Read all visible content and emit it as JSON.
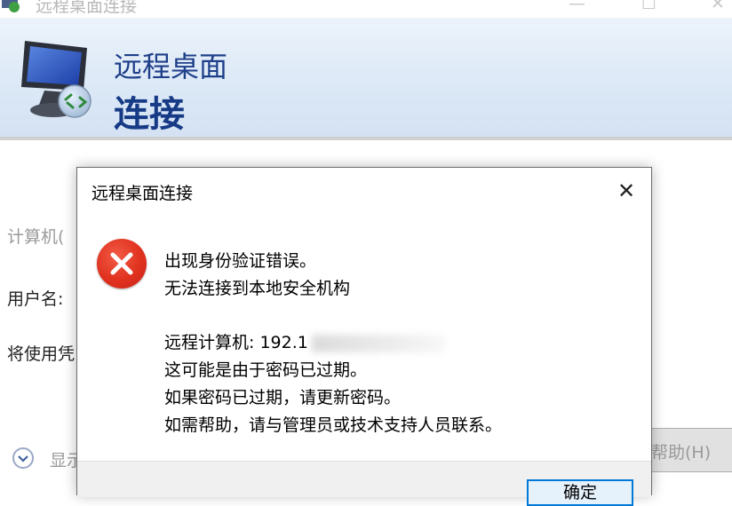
{
  "window": {
    "title": "远程桌面连接",
    "minimize_glyph": "—",
    "maximize_glyph": "☐",
    "close_glyph": "✕"
  },
  "banner": {
    "subtitle": "远程桌面",
    "title": "连接"
  },
  "background_form": {
    "computer_label": "计算机(",
    "username_label": "用户名:",
    "credentials_label": "将使用凭",
    "options_label": "显示",
    "help_label": "帮助(H)"
  },
  "dialog": {
    "title": "远程桌面连接",
    "close_glyph": "✕",
    "line1": "出现身份验证错误。",
    "line2": "无法连接到本地安全机构",
    "remote_computer_label": "远程计算机: ",
    "remote_computer_value": "192.1",
    "line4": "这可能是由于密码已过期。",
    "line5": "如果密码已过期，请更新密码。",
    "line6": "如需帮助，请与管理员或技术支持人员联系。",
    "ok_label": "确定"
  },
  "colors": {
    "accent": "#0078d7",
    "banner_text": "#1e3f8a",
    "error_red": "#e0321f"
  },
  "icons": {
    "app": "remote-desktop-icon",
    "error": "error-icon",
    "close": "close-icon",
    "options": "chevron-down-icon"
  }
}
